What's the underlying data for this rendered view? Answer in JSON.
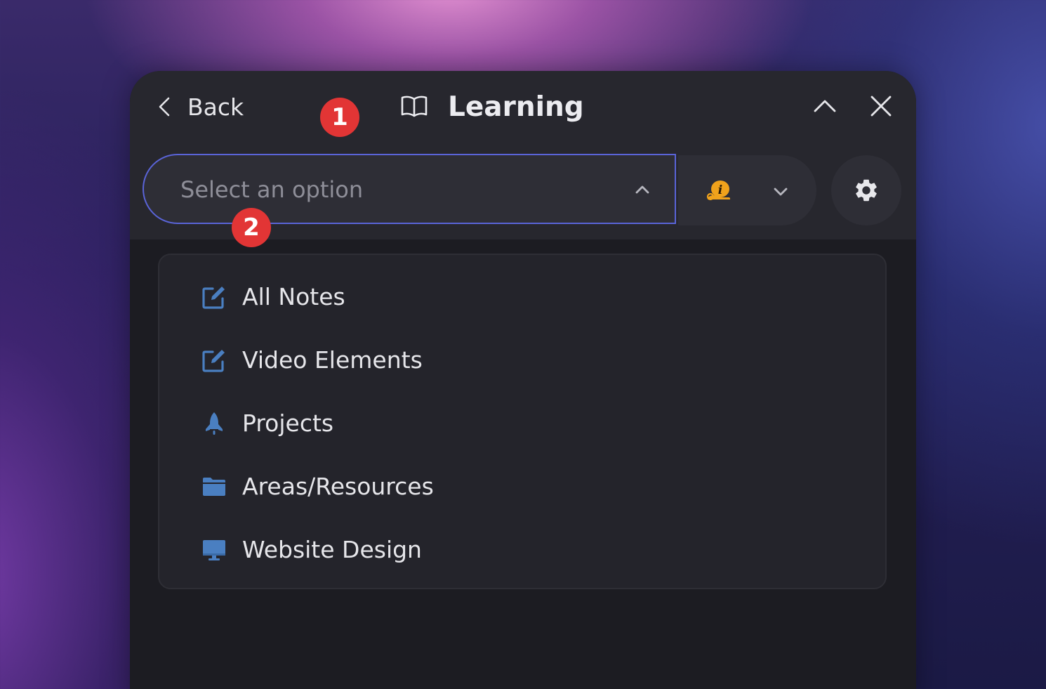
{
  "header": {
    "back_label": "Back",
    "title": "Learning",
    "title_icon": "book-open-icon",
    "collapse_icon": "chevron-up-icon",
    "close_icon": "close-icon"
  },
  "select": {
    "placeholder": "Select an option",
    "chevron_icon": "chevron-up-icon",
    "border_color": "#5a64d8"
  },
  "icon_select": {
    "current_icon": "snail-info-icon",
    "chevron_icon": "chevron-down-icon"
  },
  "settings": {
    "icon": "gear-icon"
  },
  "badges": {
    "first": "1",
    "second": "2",
    "color": "#e23535"
  },
  "dropdown": {
    "options": [
      {
        "label": "All Notes",
        "icon": "edit-note-icon"
      },
      {
        "label": "Video Elements",
        "icon": "edit-note-icon"
      },
      {
        "label": "Projects",
        "icon": "rocket-icon"
      },
      {
        "label": "Areas/Resources",
        "icon": "folder-icon"
      },
      {
        "label": "Website Design",
        "icon": "monitor-icon"
      }
    ],
    "icon_color": "#4a7fc1"
  }
}
